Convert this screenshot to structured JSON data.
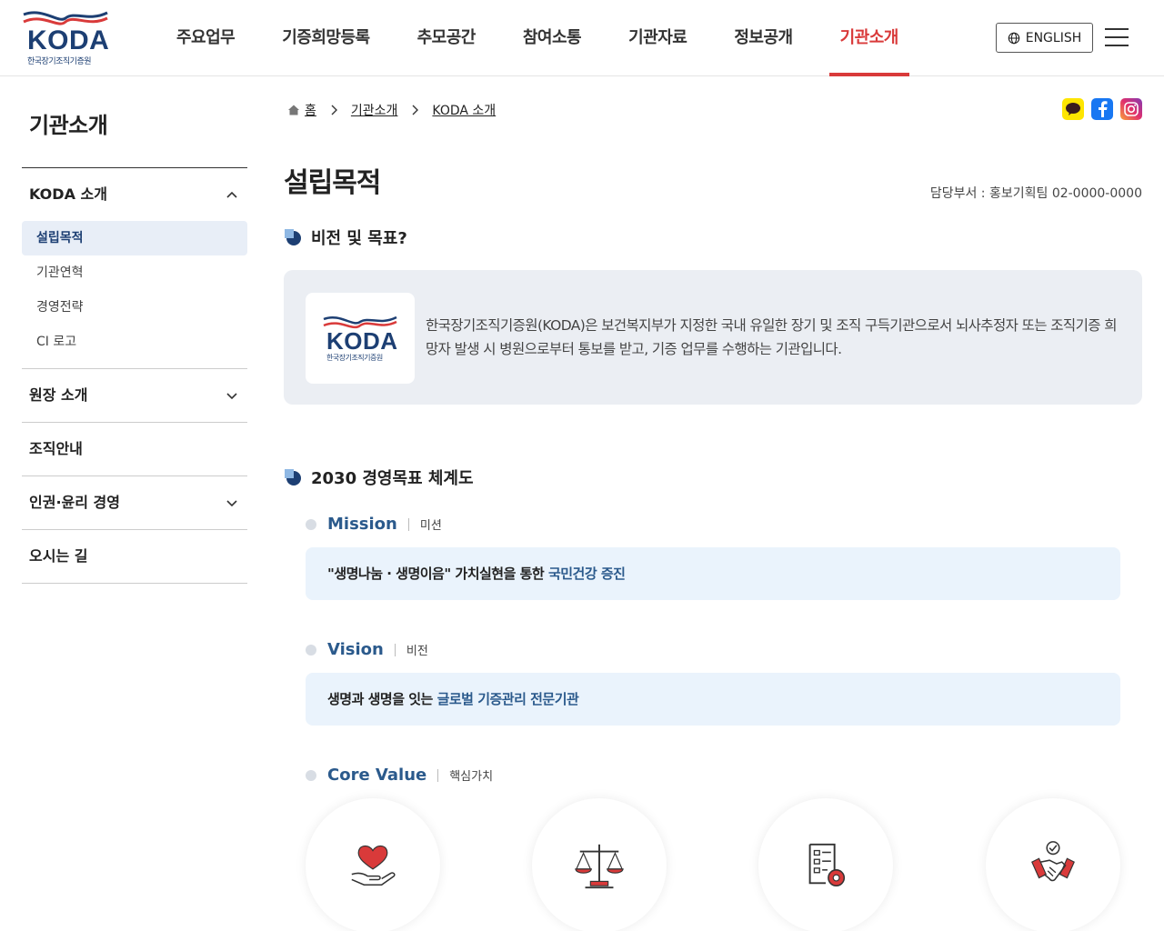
{
  "header": {
    "logo_text": "KODA",
    "logo_sub": "한국장기조직기증원",
    "nav": [
      "주요업무",
      "기증희망등록",
      "추모공간",
      "참여소통",
      "기관자료",
      "정보공개",
      "기관소개"
    ],
    "active_nav": "기관소개",
    "english_label": "ENGLISH"
  },
  "sidebar": {
    "title": "기관소개",
    "groups": [
      {
        "label": "KODA 소개",
        "items": [
          "설립목적",
          "기관연혁",
          "경영전략",
          "CI 로고"
        ],
        "active_item": "설립목적"
      },
      {
        "label": "원장 소개"
      },
      {
        "label": "조직안내"
      },
      {
        "label": "인권·윤리 경영"
      },
      {
        "label": "오시는 길"
      }
    ]
  },
  "breadcrumb": [
    "홈",
    "기관소개",
    "KODA 소개"
  ],
  "page_title": "설립목적",
  "dept": "담당부서 : 홍보기획팀 02-0000-0000",
  "sections": {
    "vision_title": "비전 및 목표?",
    "intro_text": "한국장기조직기증원(KODA)은 보건복지부가 지정한 국내 유일한 장기 및 조직 구득기관으로서 뇌사추정자 또는 조직기증 희망자 발생 시 병원으로부터 통보를 받고, 기증 업무를 수행하는 기관입니다.",
    "system_title": "2030 경영목표 체계도"
  },
  "mission": {
    "en": "Mission",
    "ko": "미션",
    "text": "\"생명나눔 · 생명이음\" 가치실현을 통한 ",
    "highlight": "국민건강 증진"
  },
  "vision": {
    "en": "Vision",
    "ko": "비전",
    "text": "생명과 생명을 잇는 ",
    "highlight": "글로벌 기증관리 전문기관"
  },
  "core_value": {
    "en": "Core Value",
    "ko": "핵심가치",
    "icons": [
      "heart-hand-icon",
      "scales-icon",
      "document-gear-icon",
      "handshake-icon"
    ]
  },
  "colors": {
    "accent_red": "#d93a3a",
    "navy": "#1d3f73",
    "highlight_blue": "#2b5a8c"
  }
}
